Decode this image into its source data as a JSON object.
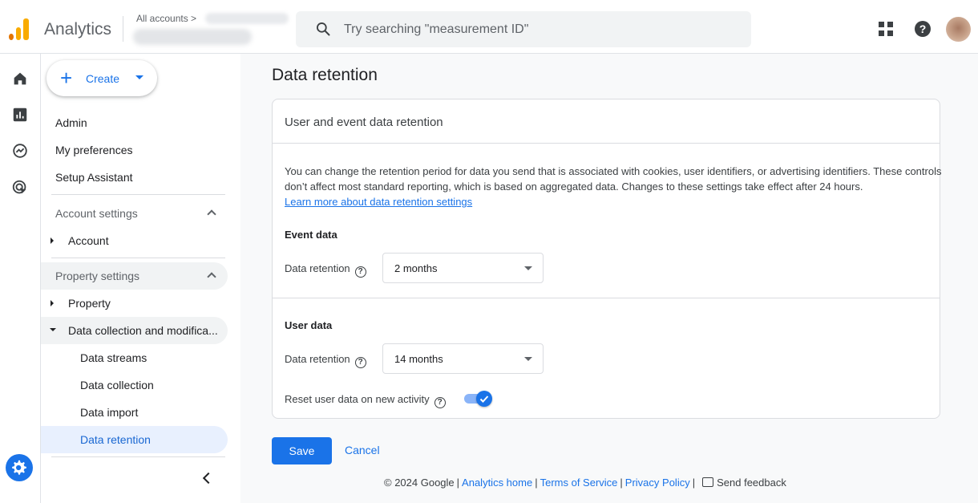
{
  "header": {
    "app_title": "Analytics",
    "account_crumb": "All accounts >",
    "search_placeholder": "Try searching \"measurement ID\""
  },
  "sidebar": {
    "create_label": "Create",
    "items": {
      "admin": "Admin",
      "my_preferences": "My preferences",
      "setup_assistant": "Setup Assistant",
      "account_settings": "Account settings",
      "account": "Account",
      "property_settings": "Property settings",
      "property": "Property",
      "data_collection_mod": "Data collection and modifica...",
      "data_streams": "Data streams",
      "data_collection": "Data collection",
      "data_import": "Data import",
      "data_retention": "Data retention"
    },
    "selected": "Data retention"
  },
  "main": {
    "page_title": "Data retention",
    "card_title": "User and event data retention",
    "description": "You can change the retention period for data you send that is associated with cookies, user identifiers, or advertising identifiers. These controls don’t affect most standard reporting, which is based on aggregated data. Changes to these settings take effect after 24 hours.",
    "learn_more": "Learn more about data retention settings",
    "event_data": {
      "heading": "Event data",
      "label": "Data retention",
      "value": "2 months"
    },
    "user_data": {
      "heading": "User data",
      "label": "Data retention",
      "value": "14 months"
    },
    "reset_label": "Reset user data on new activity",
    "reset_enabled": true,
    "save_label": "Save",
    "cancel_label": "Cancel"
  },
  "footer": {
    "copyright": "© 2024 Google",
    "analytics_home": "Analytics home",
    "terms": "Terms of Service",
    "privacy": "Privacy Policy",
    "feedback": "Send feedback"
  },
  "colors": {
    "accent": "#1a73e8",
    "selected_bg": "#e8f0fe",
    "section_bg": "#f1f3f4"
  }
}
